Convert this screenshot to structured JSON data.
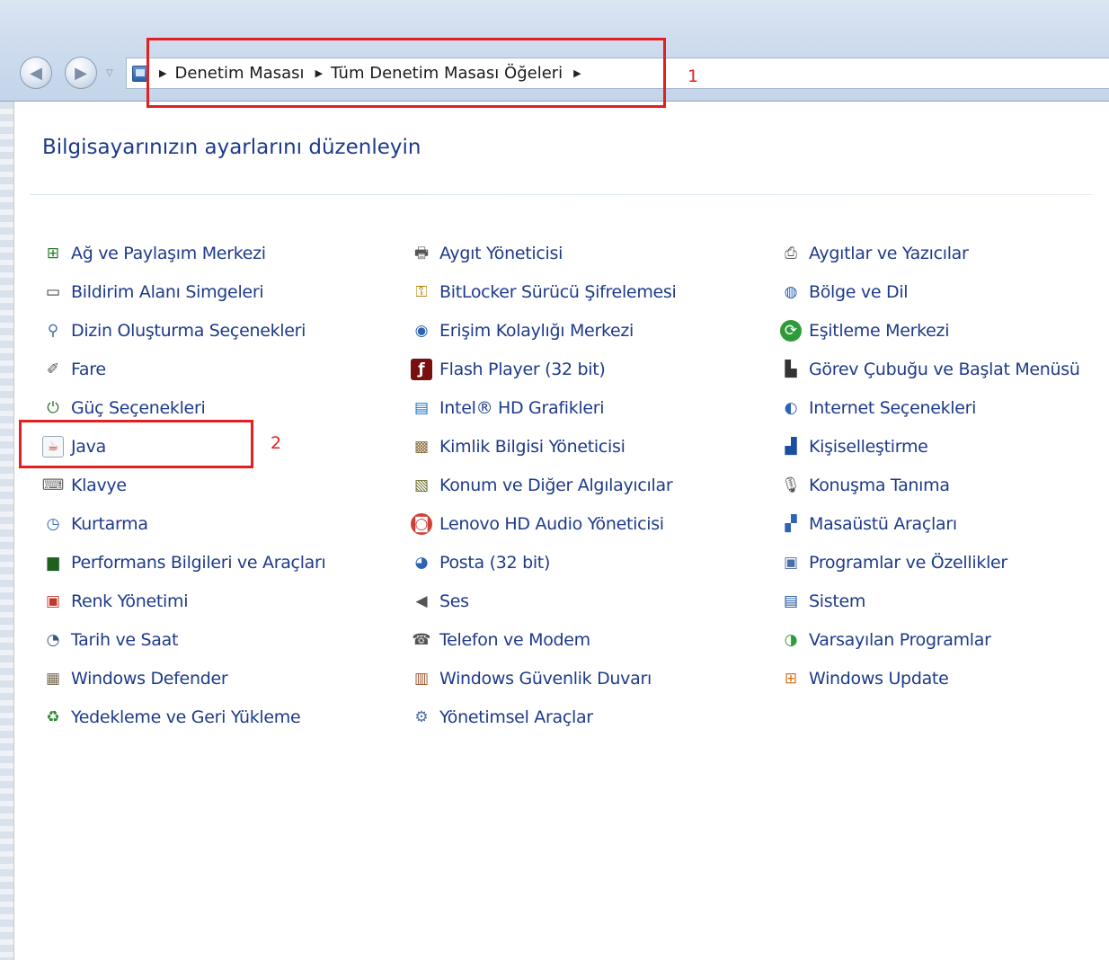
{
  "breadcrumb": {
    "items": [
      "Denetim Masası",
      "Tüm Denetim Masası Öğeleri"
    ]
  },
  "page": {
    "title": "Bilgisayarınızın ayarlarını düzenleyin"
  },
  "annotations": {
    "box1": "1",
    "box2": "2",
    "color": "#e41f1f"
  },
  "colors": {
    "link": "#1e3a8a",
    "chrome": "#cfdcee"
  },
  "columns": [
    {
      "items": [
        {
          "label": "Ağ ve Paylaşım Merkezi",
          "icon": "network-icon"
        },
        {
          "label": "Bildirim Alanı Simgeleri",
          "icon": "notification-icon"
        },
        {
          "label": "Dizin Oluşturma Seçenekleri",
          "icon": "indexing-icon"
        },
        {
          "label": "Fare",
          "icon": "mouse-icon"
        },
        {
          "label": "Güç Seçenekleri",
          "icon": "power-icon"
        },
        {
          "label": "Java",
          "icon": "java-icon"
        },
        {
          "label": "Klavye",
          "icon": "keyboard-icon"
        },
        {
          "label": "Kurtarma",
          "icon": "recovery-icon"
        },
        {
          "label": "Performans Bilgileri ve Araçları",
          "icon": "performance-icon"
        },
        {
          "label": "Renk Yönetimi",
          "icon": "color-management-icon"
        },
        {
          "label": "Tarih ve Saat",
          "icon": "clock-icon"
        },
        {
          "label": "Windows Defender",
          "icon": "defender-icon"
        },
        {
          "label": "Yedekleme ve Geri Yükleme",
          "icon": "backup-icon"
        }
      ]
    },
    {
      "items": [
        {
          "label": "Aygıt Yöneticisi",
          "icon": "device-manager-icon"
        },
        {
          "label": "BitLocker Sürücü Şifrelemesi",
          "icon": "bitlocker-icon"
        },
        {
          "label": "Erişim Kolaylığı Merkezi",
          "icon": "accessibility-icon"
        },
        {
          "label": "Flash Player (32 bit)",
          "icon": "flash-icon"
        },
        {
          "label": "Intel® HD Grafikleri",
          "icon": "intel-graphics-icon"
        },
        {
          "label": "Kimlik Bilgisi Yöneticisi",
          "icon": "credential-icon"
        },
        {
          "label": "Konum ve Diğer Algılayıcılar",
          "icon": "sensor-icon"
        },
        {
          "label": "Lenovo HD Audio Yöneticisi",
          "icon": "audio-manager-icon"
        },
        {
          "label": "Posta (32 bit)",
          "icon": "mail-icon"
        },
        {
          "label": "Ses",
          "icon": "speaker-icon"
        },
        {
          "label": "Telefon ve Modem",
          "icon": "phone-icon"
        },
        {
          "label": "Windows Güvenlik Duvarı",
          "icon": "firewall-icon"
        },
        {
          "label": "Yönetimsel Araçlar",
          "icon": "admin-tools-icon"
        }
      ]
    },
    {
      "items": [
        {
          "label": "Aygıtlar ve Yazıcılar",
          "icon": "printer-icon"
        },
        {
          "label": "Bölge ve Dil",
          "icon": "globe-icon"
        },
        {
          "label": "Eşitleme Merkezi",
          "icon": "sync-icon"
        },
        {
          "label": "Görev Çubuğu ve Başlat Menüsü",
          "icon": "taskbar-icon"
        },
        {
          "label": "Internet Seçenekleri",
          "icon": "internet-options-icon"
        },
        {
          "label": "Kişiselleştirme",
          "icon": "personalization-icon"
        },
        {
          "label": "Konuşma Tanıma",
          "icon": "microphone-icon"
        },
        {
          "label": "Masaüstü Araçları",
          "icon": "gadgets-icon"
        },
        {
          "label": "Programlar ve Özellikler",
          "icon": "programs-icon"
        },
        {
          "label": "Sistem",
          "icon": "system-icon"
        },
        {
          "label": "Varsayılan Programlar",
          "icon": "default-programs-icon"
        },
        {
          "label": "Windows Update",
          "icon": "windows-update-icon"
        }
      ]
    }
  ]
}
